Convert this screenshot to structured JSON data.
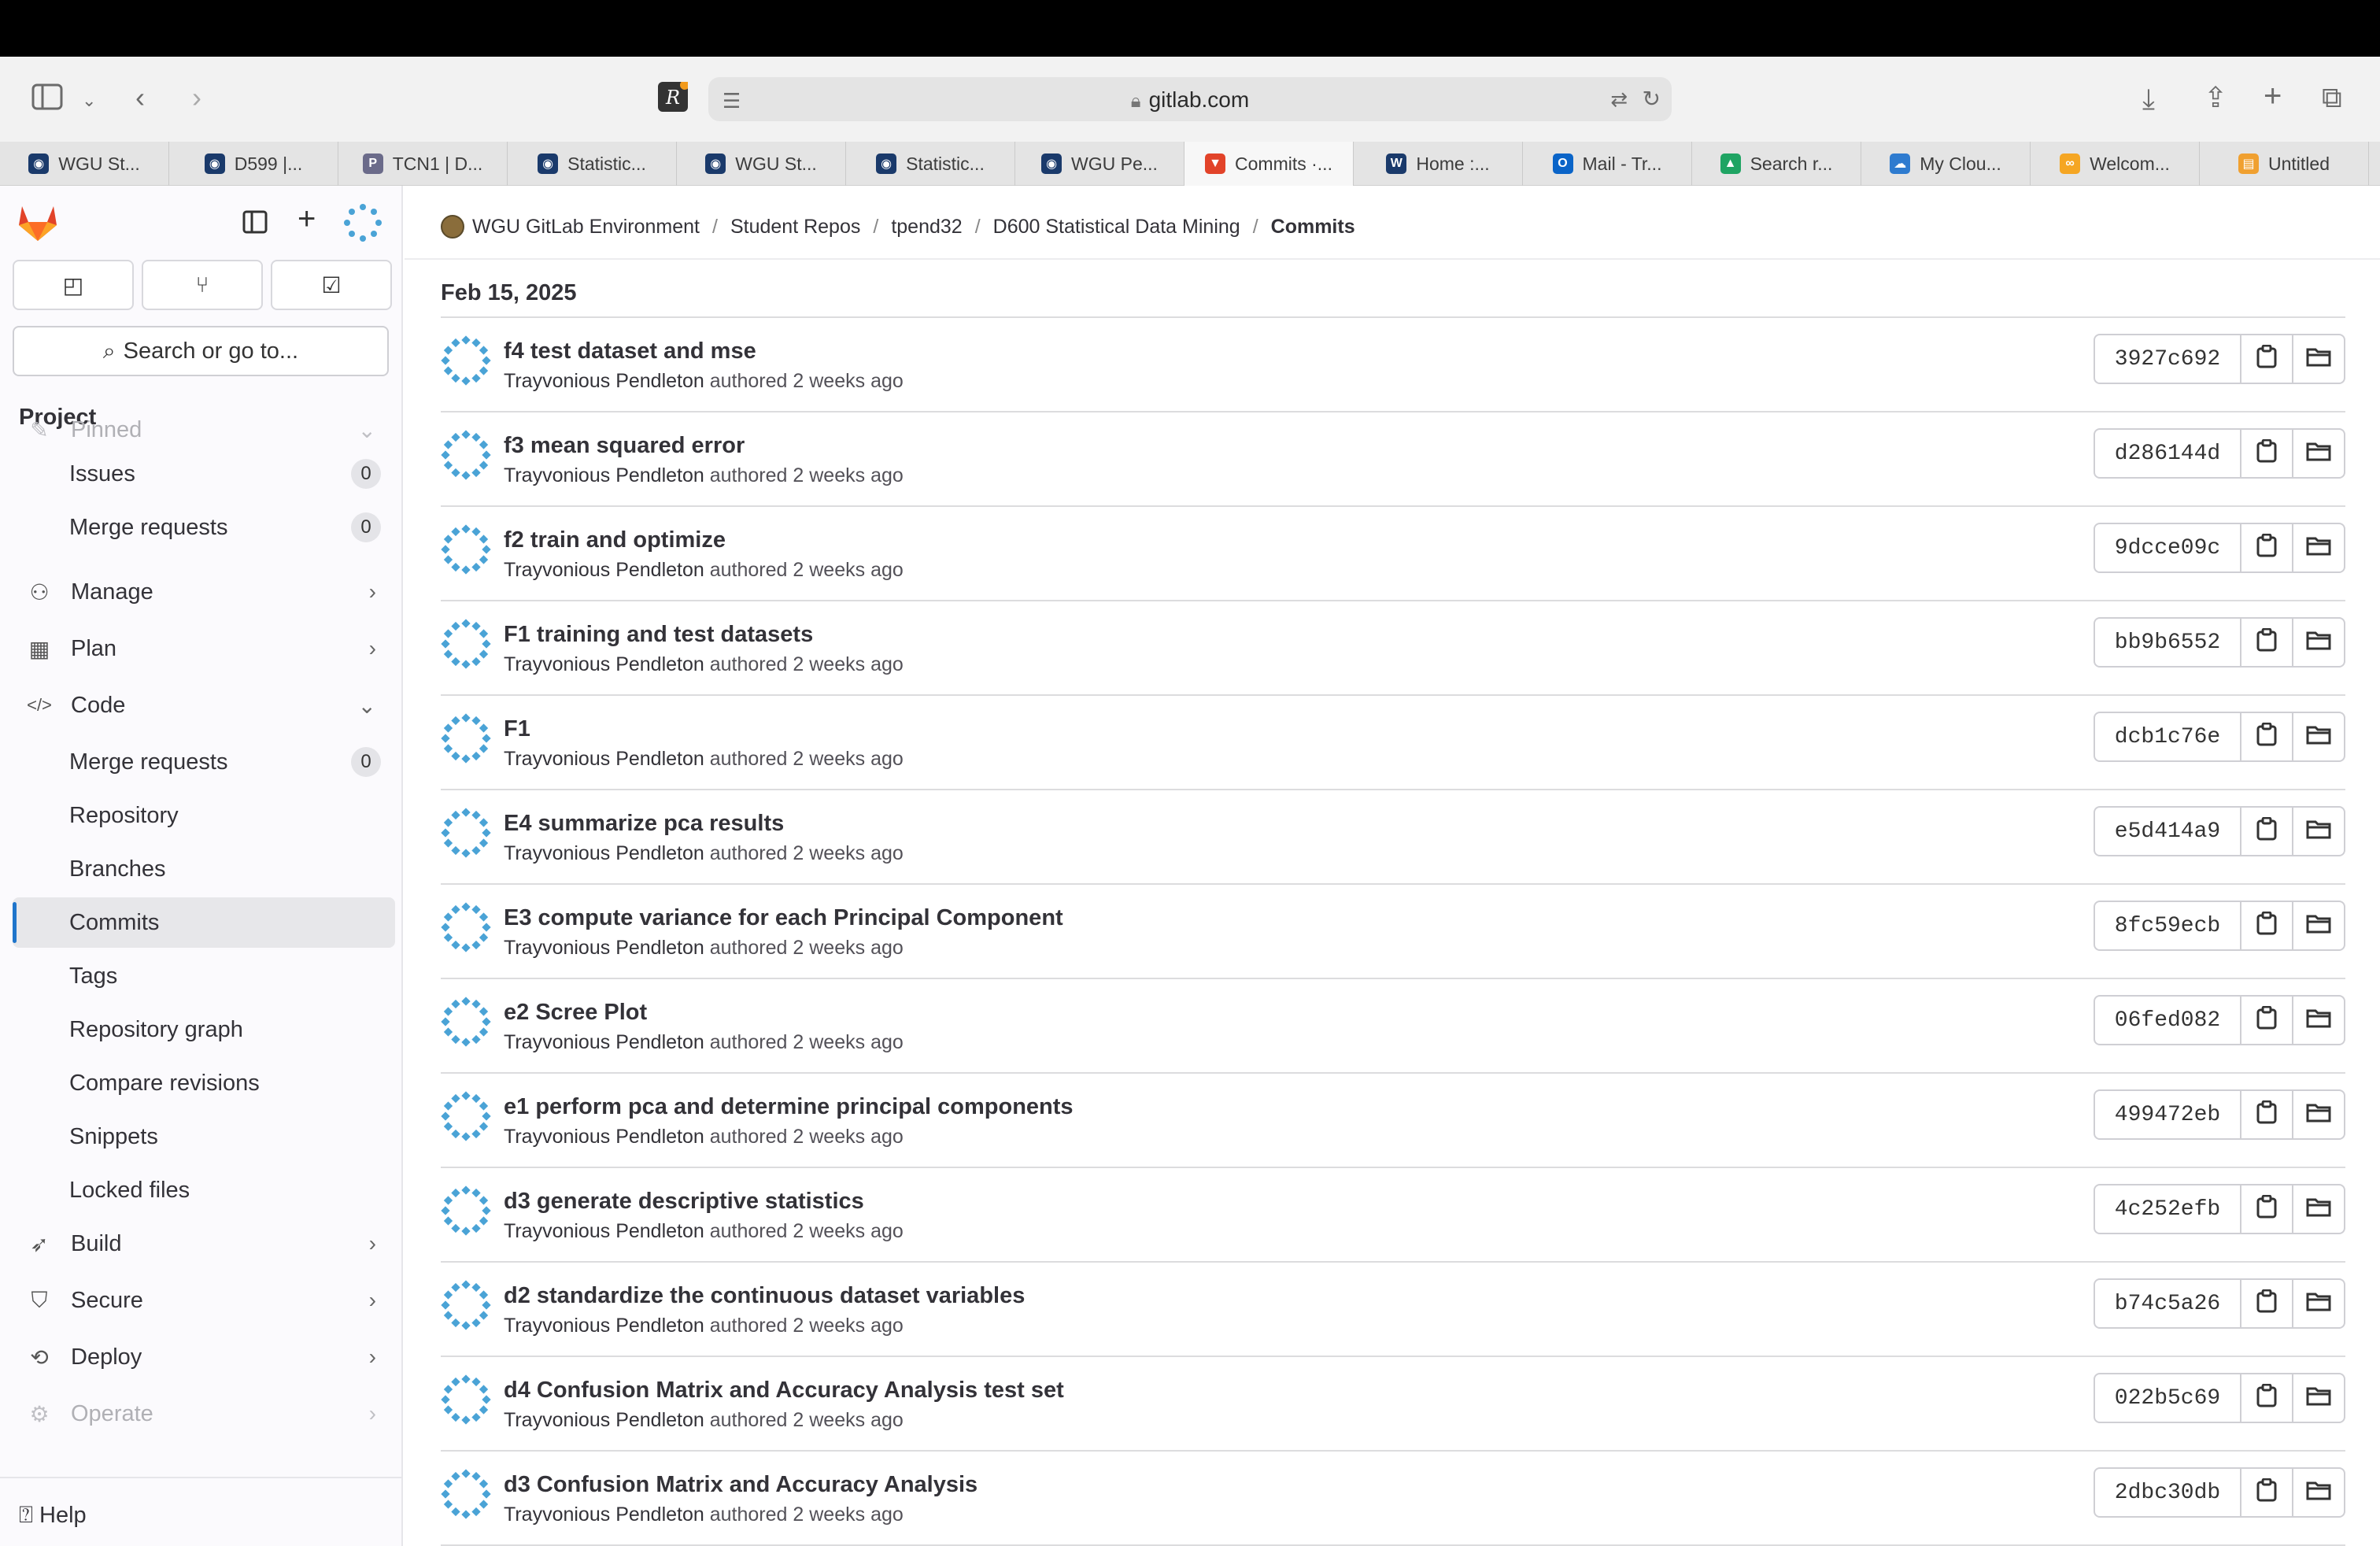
{
  "browser": {
    "url": "gitlab.com",
    "tabs": [
      {
        "label": "WGU St...",
        "icon": "wgu-owl-icon",
        "color": "#1a3a6b"
      },
      {
        "label": "D599 |...",
        "icon": "wgu-owl-icon",
        "color": "#1a3a6b"
      },
      {
        "label": "TCN1 | D...",
        "icon": "p-letter-icon",
        "color": "#6b6b8a"
      },
      {
        "label": "Statistic...",
        "icon": "wgu-owl-icon",
        "color": "#1a3a6b"
      },
      {
        "label": "WGU St...",
        "icon": "wgu-owl-icon",
        "color": "#1a3a6b"
      },
      {
        "label": "Statistic...",
        "icon": "wgu-owl-icon",
        "color": "#1a3a6b"
      },
      {
        "label": "WGU Pe...",
        "icon": "wgu-owl-icon",
        "color": "#1a3a6b"
      },
      {
        "label": "Commits ·...",
        "icon": "gitlab-icon",
        "color": "#e24329",
        "active": true
      },
      {
        "label": "Home :...",
        "icon": "wgu-icon",
        "color": "#1a3a6b"
      },
      {
        "label": "Mail - Tr...",
        "icon": "outlook-icon",
        "color": "#0a64c8"
      },
      {
        "label": "Search r...",
        "icon": "google-drive-icon",
        "color": "#1fa463"
      },
      {
        "label": "My Clou...",
        "icon": "cloud-icon",
        "color": "#2e7bcf"
      },
      {
        "label": "Welcom...",
        "icon": "co-icon",
        "color": "#f5a623"
      },
      {
        "label": "Untitled",
        "icon": "notebook-icon",
        "color": "#f0a030"
      }
    ]
  },
  "sidebar": {
    "search_label": "Search or go to...",
    "section_title": "Project",
    "items": [
      {
        "label": "Pinned",
        "icon": "pin-icon"
      },
      {
        "label": "Issues",
        "badge": "0"
      },
      {
        "label": "Merge requests",
        "badge": "0"
      },
      {
        "label": "Manage",
        "icon": "users-icon"
      },
      {
        "label": "Plan",
        "icon": "calendar-icon"
      },
      {
        "label": "Code",
        "icon": "code-icon"
      },
      {
        "label": "Merge requests",
        "badge": "0"
      },
      {
        "label": "Repository"
      },
      {
        "label": "Branches"
      },
      {
        "label": "Commits"
      },
      {
        "label": "Tags"
      },
      {
        "label": "Repository graph"
      },
      {
        "label": "Compare revisions"
      },
      {
        "label": "Snippets"
      },
      {
        "label": "Locked files"
      },
      {
        "label": "Build",
        "icon": "rocket-icon"
      },
      {
        "label": "Secure",
        "icon": "shield-icon"
      },
      {
        "label": "Deploy",
        "icon": "deploy-icon"
      },
      {
        "label": "Operate",
        "icon": "operate-icon"
      }
    ],
    "help_label": "Help"
  },
  "breadcrumb": [
    "WGU GitLab Environment",
    "Student Repos",
    "tpend32",
    "D600 Statistical Data Mining",
    "Commits"
  ],
  "date_header": "Feb 15, 2025",
  "author": "Trayvonious Pendleton",
  "authored_text": "authored",
  "time_ago": "2 weeks ago",
  "commits": [
    {
      "title": "f4 test dataset and mse",
      "sha": "3927c692"
    },
    {
      "title": "f3 mean squared error",
      "sha": "d286144d"
    },
    {
      "title": "f2 train and optimize",
      "sha": "9dcce09c"
    },
    {
      "title": "F1 training and test datasets",
      "sha": "bb9b6552"
    },
    {
      "title": "F1",
      "sha": "dcb1c76e"
    },
    {
      "title": "E4 summarize pca results",
      "sha": "e5d414a9"
    },
    {
      "title": "E3 compute variance for each Principal Component",
      "sha": "8fc59ecb"
    },
    {
      "title": "e2 Scree Plot",
      "sha": "06fed082"
    },
    {
      "title": "e1 perform pca and determine principal components",
      "sha": "499472eb"
    },
    {
      "title": "d3 generate descriptive statistics",
      "sha": "4c252efb"
    },
    {
      "title": "d2 standardize the continuous dataset variables",
      "sha": "b74c5a26"
    },
    {
      "title": "d4 Confusion Matrix and Accuracy Analysis test set",
      "sha": "022b5c69"
    },
    {
      "title": "d3 Confusion Matrix and Accuracy Analysis",
      "sha": "2dbc30db"
    }
  ],
  "colors": {
    "accent": "#1f75cb",
    "gitlab_orange": "#e24329",
    "avatar": "#4aa3d6"
  }
}
